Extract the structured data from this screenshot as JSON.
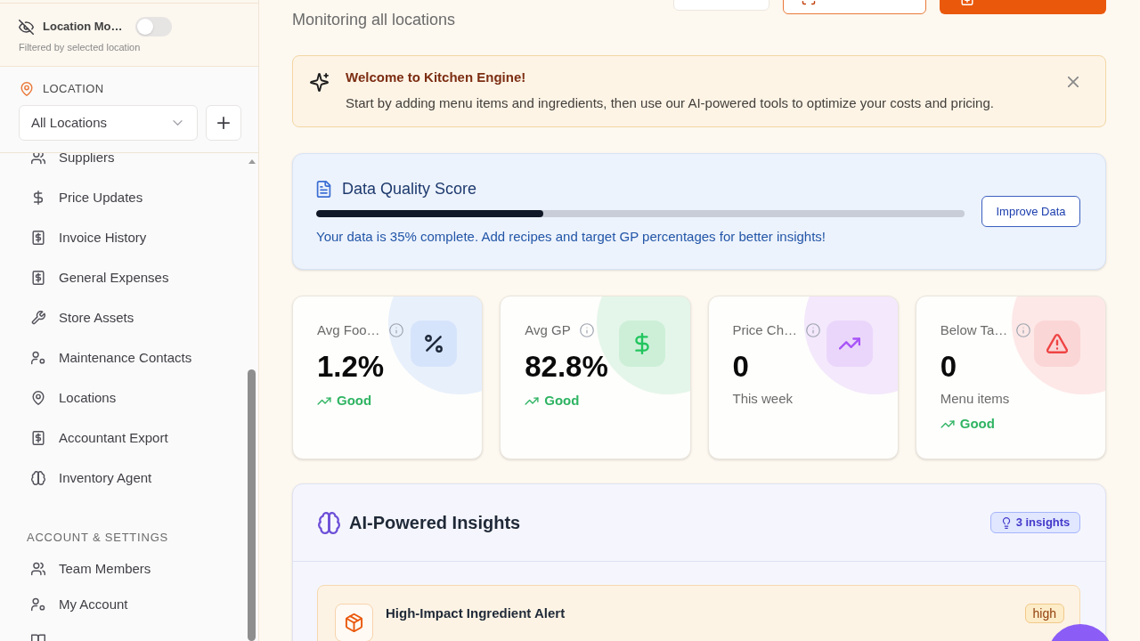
{
  "sidebar": {
    "location_mode": {
      "label": "Location Mo…",
      "on": false,
      "caption": "Filtered by selected location"
    },
    "location": {
      "heading": "LOCATION",
      "select_value": "All Locations"
    },
    "nav": [
      {
        "label": "Suppliers",
        "selected": false
      },
      {
        "label": "Price Updates",
        "selected": false
      },
      {
        "label": "Invoice History",
        "selected": false
      },
      {
        "label": "General Expenses",
        "selected": false
      },
      {
        "label": "Store Assets",
        "selected": false
      },
      {
        "label": "Maintenance Contacts",
        "selected": false
      },
      {
        "label": "Locations",
        "selected": false
      },
      {
        "label": "Accountant Export",
        "selected": false
      },
      {
        "label": "Inventory Agent",
        "selected": false
      }
    ],
    "sections": [
      {
        "heading": "ACCOUNT & SETTINGS",
        "items": [
          {
            "label": "Team Members",
            "selected": false
          },
          {
            "label": "My Account",
            "selected": false
          },
          {
            "selected": false
          }
        ]
      }
    ]
  },
  "header": {
    "subtitle": "Monitoring all locations",
    "buttons": [
      {
        "kind": "plain"
      },
      {
        "kind": "outline"
      },
      {
        "kind": "primary"
      }
    ]
  },
  "welcome": {
    "title": "Welcome to Kitchen Engine!",
    "text": "Start by adding menu items and ingredients, then use our AI-powered tools to optimize your costs and pricing."
  },
  "data_quality": {
    "title": "Data Quality Score",
    "level": 0.35,
    "text": "Your data is 35% complete. Add recipes and target GP percentages for better insights!",
    "button": "Improve Data"
  },
  "stats": [
    {
      "label": "Avg Foo…",
      "value": "1.2%",
      "status": "Good",
      "color": "#d6e4fb"
    },
    {
      "label": "Avg GP",
      "value": "82.8%",
      "status": "Good",
      "color": "#cdefd8"
    },
    {
      "label": "Price Ch…",
      "value": "0",
      "caption": "This week",
      "color": "#ebd6fb"
    },
    {
      "label": "Below Ta…",
      "value": "0",
      "caption": "Menu items",
      "status": "Good",
      "color": "#fbd6d6"
    }
  ],
  "insights": {
    "title": "AI-Powered Insights",
    "badge": "3 insights",
    "items": [
      {
        "title": "High-Impact Ingredient Alert",
        "priority": "high"
      }
    ]
  }
}
